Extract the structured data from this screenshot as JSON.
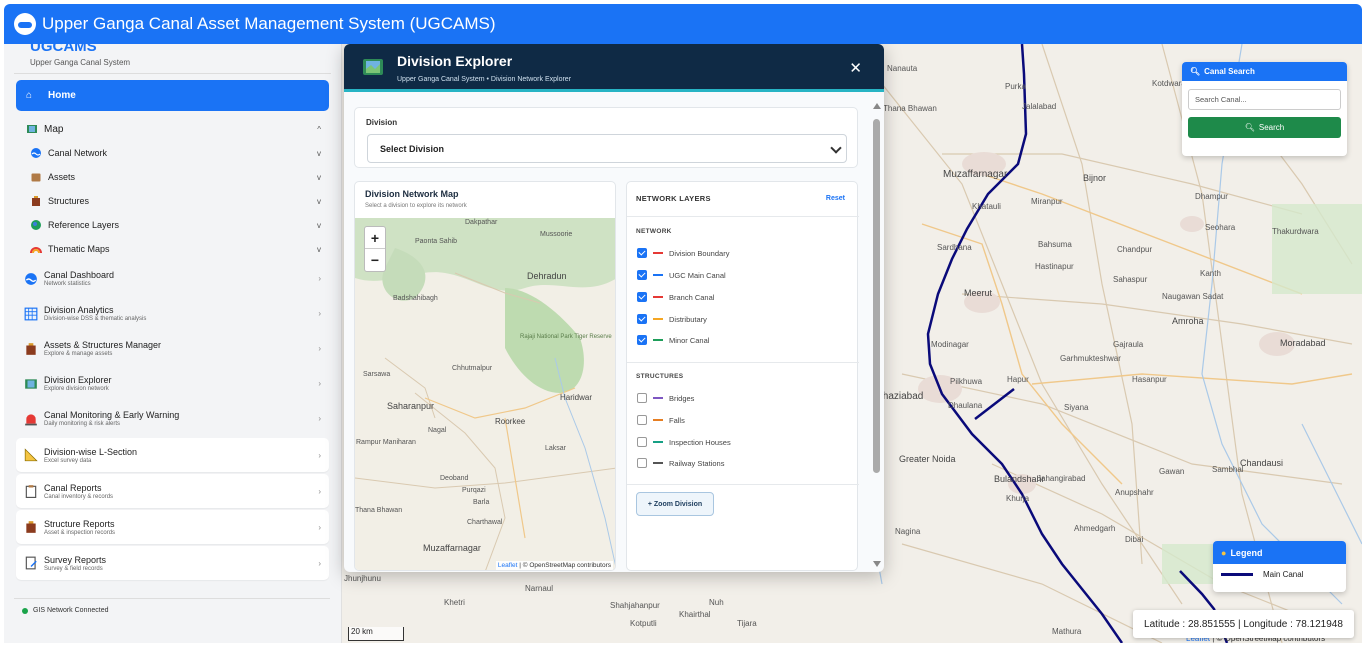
{
  "app": {
    "title": "Upper Ganga Canal Asset Management System (UGCAMS)",
    "brand": "UGCAMS",
    "brand_sub": "Upper Ganga Canal System"
  },
  "sidebar": {
    "home": "Home",
    "map": "Map",
    "map_items": [
      {
        "label": "Canal Network",
        "icon": "canal-icon"
      },
      {
        "label": "Assets",
        "icon": "box-icon"
      },
      {
        "label": "Structures",
        "icon": "building-icon"
      },
      {
        "label": "Reference Layers",
        "icon": "globe-icon"
      },
      {
        "label": "Thematic Maps",
        "icon": "rainbow-icon"
      }
    ],
    "nav": [
      {
        "title": "Canal Dashboard",
        "sub": "Network statistics"
      },
      {
        "title": "Division Analytics",
        "sub": "Division-wise DSS & thematic analysis"
      },
      {
        "title": "Assets & Structures Manager",
        "sub": "Explore & manage assets"
      },
      {
        "title": "Division Explorer",
        "sub": "Explore division network"
      },
      {
        "title": "Canal Monitoring & Early Warning",
        "sub": "Daily monitoring & risk alerts"
      }
    ],
    "cards": [
      {
        "title": "Division-wise L-Section",
        "sub": "Excel survey data"
      },
      {
        "title": "Canal Reports",
        "sub": "Canal inventory & records"
      },
      {
        "title": "Structure Reports",
        "sub": "Asset & inspection records"
      },
      {
        "title": "Survey Reports",
        "sub": "Survey & field records"
      }
    ],
    "status": "GIS Network Connected"
  },
  "modal": {
    "title": "Division Explorer",
    "subtitle": "Upper Ganga Canal System • Division Network Explorer",
    "close": "✕",
    "division_label": "Division",
    "division_value": "Select Division",
    "map_title": "Division Network Map",
    "map_sub": "Select a division to explore its network",
    "layers_title": "NETWORK LAYERS",
    "reset": "Reset",
    "network_group": "NETWORK",
    "network_layers": [
      {
        "label": "Division Boundary",
        "color": "#e53935",
        "checked": true
      },
      {
        "label": "UGC Main Canal",
        "color": "#1a73f5",
        "checked": true
      },
      {
        "label": "Branch Canal",
        "color": "#e53935",
        "checked": true
      },
      {
        "label": "Distributary",
        "color": "#f5a623",
        "checked": true
      },
      {
        "label": "Minor Canal",
        "color": "#1e9e5a",
        "checked": true
      }
    ],
    "structures_group": "STRUCTURES",
    "structure_layers": [
      {
        "label": "Bridges",
        "color": "#7e57c2",
        "checked": false
      },
      {
        "label": "Falls",
        "color": "#e67e22",
        "checked": false
      },
      {
        "label": "Inspection Houses",
        "color": "#16a085",
        "checked": false
      },
      {
        "label": "Railway Stations",
        "color": "#555555",
        "checked": false
      }
    ],
    "zoom_division": "+ Zoom Division",
    "mini_places": [
      "Dakpathar",
      "Mussoorie",
      "Paonta Sahib",
      "Dehradun",
      "Badshahibagh",
      "Rajaji National Park Tiger Reserve",
      "Chhutmalpur",
      "Sarsawa",
      "Saharanpur",
      "Haridwar",
      "Roorkee",
      "Nagal",
      "Rampur Maniharan",
      "Laksar",
      "Deoband",
      "Purqazi",
      "Barla",
      "Thana Bhawan",
      "Charthawal",
      "Muzaffarnagar"
    ],
    "mini_attrib_leaflet": "Leaflet",
    "mini_attrib_rest": " | © OpenStreetMap contributors"
  },
  "search": {
    "title": "Canal Search",
    "placeholder": "Search Canal...",
    "button": "Search"
  },
  "legend": {
    "title": "Legend",
    "item": "Main Canal"
  },
  "coords": "Latitude : 28.851555 | Longitude : 78.121948",
  "scale": "20 km",
  "attrib_leaflet": "Leaflet",
  "attrib_rest": " | © OpenStreetMap contributors",
  "map_places": [
    "Nanauta",
    "Purka",
    "Kotdwara",
    "Jalalabad",
    "Thana Bhawan",
    "Muzaffarnagar",
    "Bijnor",
    "Khatauli",
    "Miranpur",
    "Dhampur",
    "Sardhana",
    "Bahsuma",
    "Seohara",
    "Thakurdwara",
    "Meerut",
    "Chandpur",
    "Sahaspur",
    "Hastinapur",
    "Kanth",
    "Naugawan Sadat",
    "Amroha",
    "Modinagar",
    "Gajraula",
    "Moradabad",
    "Garhmukteshwar",
    "Pilkhuwa",
    "Hapur",
    "Hasanpur",
    "Ghaziabad",
    "Dhaulana",
    "Siyana",
    "Greater Noida",
    "Bulandshahr",
    "Gawan",
    "Chandausi",
    "Jahangirabad",
    "Anupshahr",
    "Sambhal",
    "Khurja",
    "Ahmedgarh",
    "Dibai",
    "Jhunjhunu",
    "Narnaul",
    "Khetri",
    "Shahjahanpur",
    "Kotputli",
    "Tijara",
    "Nagina",
    "Khairthal",
    "Nuh",
    "Mathura"
  ]
}
